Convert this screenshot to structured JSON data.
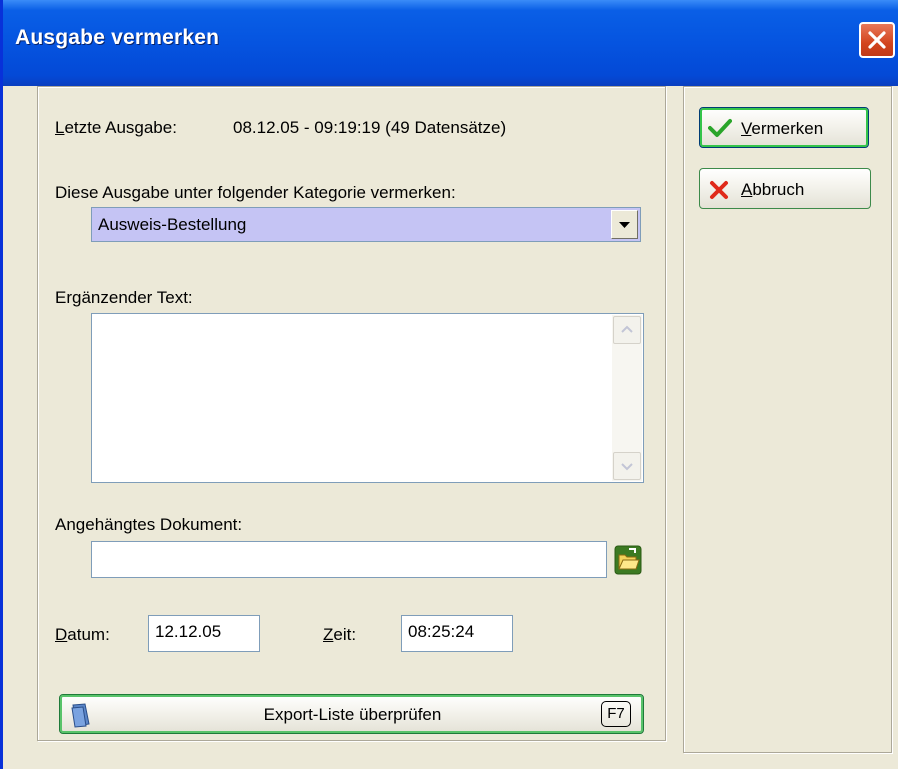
{
  "window": {
    "title": "Ausgabe vermerken"
  },
  "info": {
    "last_output_label": "Letzte Ausgabe:",
    "last_output_value": "08.12.05 - 09:19:19 (49 Datensätze)"
  },
  "category": {
    "label": "Diese Ausgabe unter folgender Kategorie vermerken:",
    "selected": "Ausweis-Bestellung",
    "highlight_color": "#c5c4f4"
  },
  "supplement": {
    "label": "Ergänzender Text:",
    "value": ""
  },
  "document": {
    "label": "Angehängtes Dokument:",
    "value": ""
  },
  "date": {
    "label_mnemonic": "D",
    "label_rest": "atum:",
    "value": "12.12.05"
  },
  "time": {
    "label_mnemonic": "Z",
    "label_rest": "eit:",
    "value": "08:25:24"
  },
  "export_button": {
    "label": "Export-Liste überprüfen",
    "shortcut": "F7"
  },
  "actions": {
    "confirm_mnemonic": "V",
    "confirm_rest": "ermerken",
    "cancel_mnemonic": "A",
    "cancel_rest": "bbruch"
  },
  "icons": {
    "close": "close-icon",
    "confirm": "checkmark-icon",
    "cancel": "x-icon",
    "open_folder": "open-folder-icon",
    "document": "document-icon"
  }
}
